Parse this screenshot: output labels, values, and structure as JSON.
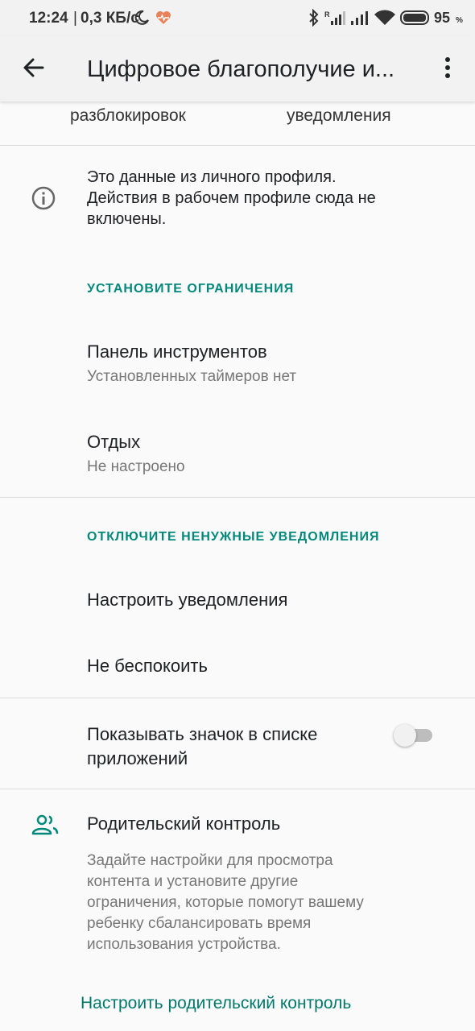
{
  "status_bar": {
    "time": "12:24",
    "speed": "0,3 КБ/с",
    "battery": "95"
  },
  "app_bar": {
    "title": "Цифровое благополучие и..."
  },
  "stats_row": {
    "unlocks_label": "разблокировок",
    "notifications_label": "уведомления"
  },
  "info": {
    "text_line1": "Это данные из личного профиля.",
    "text_line2": "Действия в рабочем профиле сюда не",
    "text_line3": "включены."
  },
  "limits_section": {
    "header": "УСТАНОВИТЕ ОГРАНИЧЕНИЯ",
    "items": [
      {
        "title": "Панель инструментов",
        "subtitle": "Установленных таймеров нет"
      },
      {
        "title": "Отдых",
        "subtitle": "Не настроено"
      }
    ]
  },
  "notifications_section": {
    "header": "ОТКЛЮЧИТЕ НЕНУЖНЫЕ УВЕДОМЛЕНИЯ",
    "items": [
      {
        "title": "Настроить уведомления"
      },
      {
        "title": "Не беспокоить"
      }
    ]
  },
  "show_icon": {
    "line1": "Показывать значок в списке",
    "line2": "приложений",
    "enabled": false
  },
  "parental": {
    "title": "Родительский контроль",
    "desc_line1": "Задайте настройки для просмотра",
    "desc_line2": "контента и установите другие",
    "desc_line3": "ограничения, которые помогут вашему",
    "desc_line4": "ребенку сбалансировать время",
    "desc_line5": "использования устройства.",
    "button": "Настроить родительский контроль"
  },
  "colors": {
    "accent": "#00897b",
    "background": "#fafafa",
    "app_bar": "#f2f2f2",
    "heart_icon": "#e8825a"
  }
}
